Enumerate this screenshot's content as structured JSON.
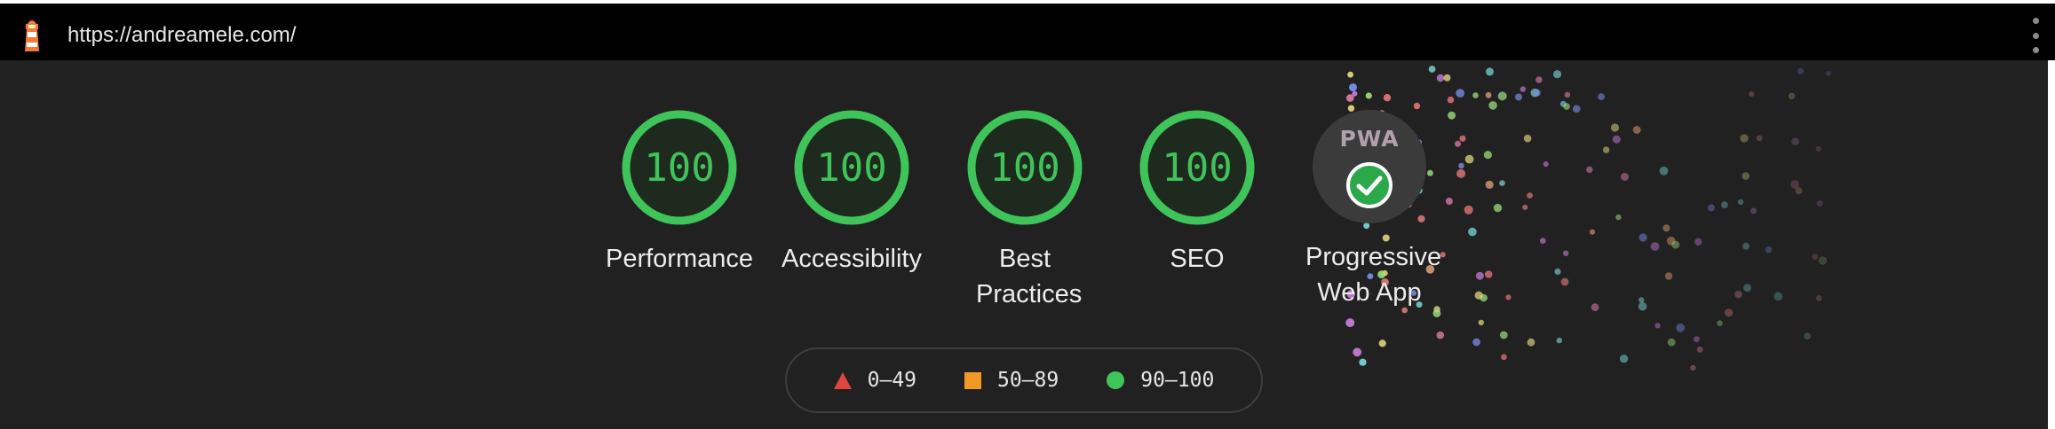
{
  "browser": {
    "url": "https://andreamele.com/",
    "logo_icon": "lighthouse-icon",
    "menu_icon": "kebab-menu-icon"
  },
  "gauges": [
    {
      "label": "Performance",
      "score": "100",
      "color": "#3fc45a"
    },
    {
      "label": "Accessibility",
      "score": "100",
      "color": "#3fc45a"
    },
    {
      "label": "Best Practices",
      "score": "100",
      "color": "#3fc45a"
    },
    {
      "label": "SEO",
      "score": "100",
      "color": "#3fc45a"
    },
    {
      "label": "Progressive Web App",
      "badge_text": "PWA",
      "badge_icon": "checkmark-badge-icon",
      "color": "#3fc45a"
    }
  ],
  "legend": [
    {
      "range": "0–49",
      "shape": "triangle-icon",
      "color": "#e5453f"
    },
    {
      "range": "50–89",
      "shape": "square-icon",
      "color": "#f09a23"
    },
    {
      "range": "90–100",
      "shape": "circle-icon",
      "color": "#3fc45a"
    }
  ],
  "colors": {
    "background": "#212121",
    "urlbar": "#000000",
    "pass": "#3fc45a"
  }
}
